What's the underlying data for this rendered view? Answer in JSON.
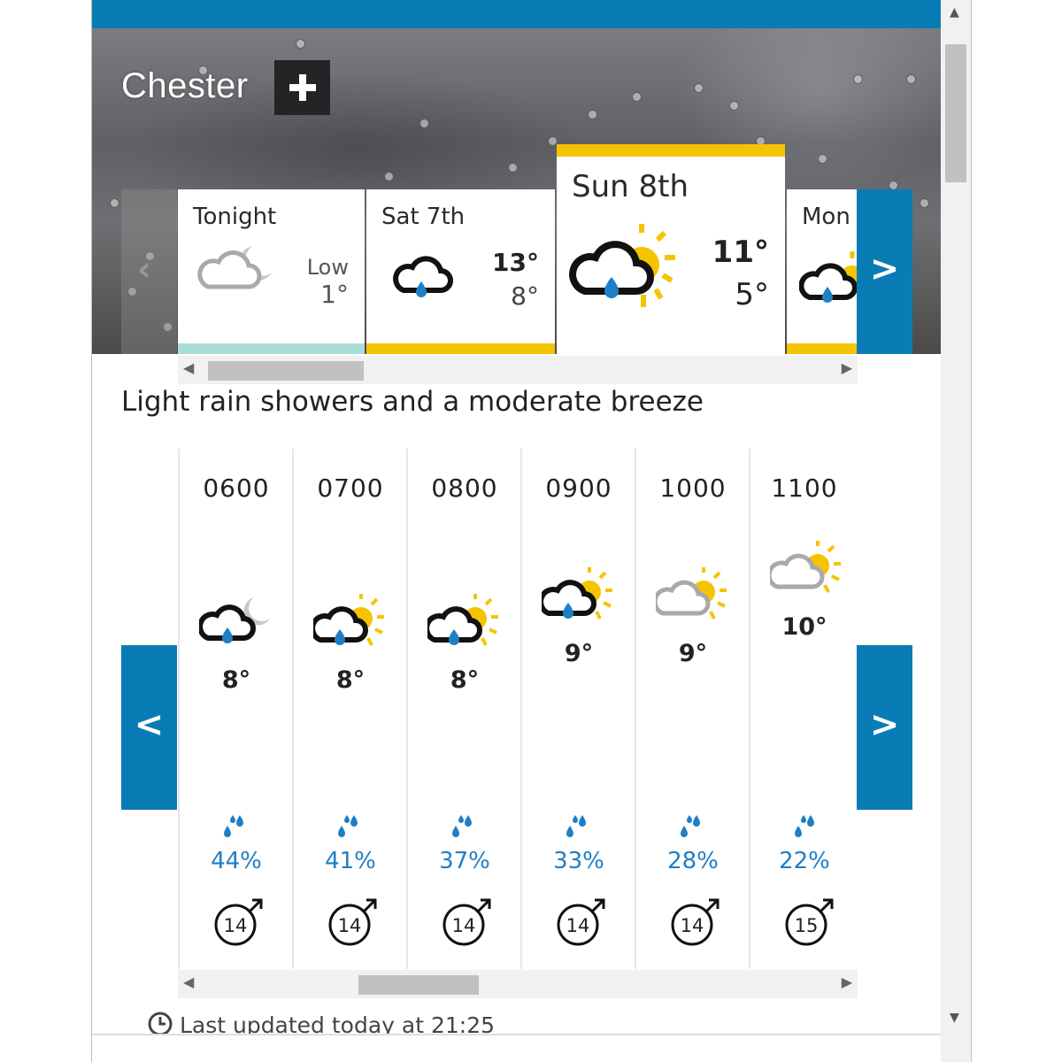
{
  "theme": {
    "brand_blue": "#0a7cb5",
    "sun_yellow": "#f5c400",
    "rain_blue": "#1f7fc6",
    "strip_teal": "#a9dcd9"
  },
  "location": {
    "name": "Chester",
    "add_icon": "plus-icon"
  },
  "days": [
    {
      "label": "Tonight",
      "sub_label": "Low",
      "low": "1°",
      "icon": "cloud-moon-icon",
      "strip_color": "#a9dcd9"
    },
    {
      "label": "Sat 7th",
      "high": "13°",
      "low": "8°",
      "icon": "cloud-rain-icon",
      "strip_color": "#f5c400"
    },
    {
      "label": "Sun 8th",
      "high": "11°",
      "low": "5°",
      "icon": "cloud-rain-sun-icon",
      "selected": true,
      "strip_color": "#f5c400"
    },
    {
      "label": "Mon",
      "icon": "cloud-rain-sun-icon",
      "strip_color": "#f5c400"
    }
  ],
  "summary": "Light rain showers and a moderate breeze",
  "hours": [
    {
      "time": "0600",
      "icon": "cloud-rain-moon-icon",
      "temp": "8°",
      "rain_chance": "44%",
      "wind_speed": "14"
    },
    {
      "time": "0700",
      "icon": "cloud-rain-sun-icon",
      "temp": "8°",
      "rain_chance": "41%",
      "wind_speed": "14"
    },
    {
      "time": "0800",
      "icon": "cloud-rain-sun-icon",
      "temp": "8°",
      "rain_chance": "37%",
      "wind_speed": "14"
    },
    {
      "time": "0900",
      "icon": "cloud-rain-sun-icon",
      "temp": "9°",
      "rain_chance": "33%",
      "wind_speed": "14"
    },
    {
      "time": "1000",
      "icon": "cloud-sun-icon",
      "temp": "9°",
      "rain_chance": "28%",
      "wind_speed": "14"
    },
    {
      "time": "1100",
      "icon": "cloud-sun-icon",
      "temp": "10°",
      "rain_chance": "22%",
      "wind_speed": "15"
    }
  ],
  "nav": {
    "prev_label": "<",
    "next_label": ">"
  },
  "footer": {
    "last_updated": "Last updated today at 21:25",
    "clock_icon": "clock-icon"
  }
}
